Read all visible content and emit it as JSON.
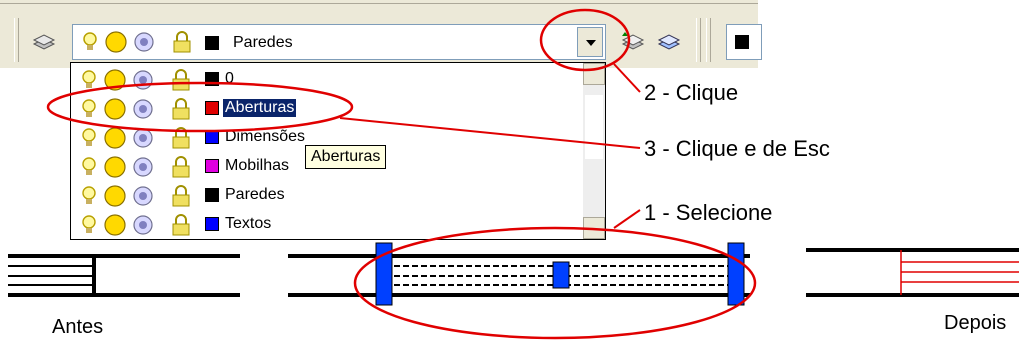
{
  "toolbar": {
    "selected_layer": "Paredes",
    "selected_color": "#000000"
  },
  "dropdown": {
    "items": [
      {
        "label": "0",
        "color": "#000000"
      },
      {
        "label": "Aberturas",
        "color": "#e00000"
      },
      {
        "label": "Dimensões",
        "color": "#0000ff"
      },
      {
        "label": "Mobilhas",
        "color": "#e000e0"
      },
      {
        "label": "Paredes",
        "color": "#000000"
      },
      {
        "label": "Textos",
        "color": "#0000ff"
      }
    ],
    "selected_index": 1
  },
  "tooltip": "Aberturas",
  "annotations": {
    "step2": "2 - Clique",
    "step3": "3 - Clique e de Esc",
    "step1": "1 - Selecione"
  },
  "captions": {
    "before": "Antes",
    "after": "Depois"
  },
  "colors": {
    "annotation_red": "#e00000",
    "grip_blue": "#0040ff",
    "selection_blue": "#0a246a"
  },
  "icons": [
    "layers-icon",
    "lightbulb-icon",
    "sun-icon",
    "freeze-icon",
    "lock-icon",
    "color-swatch-icon"
  ]
}
